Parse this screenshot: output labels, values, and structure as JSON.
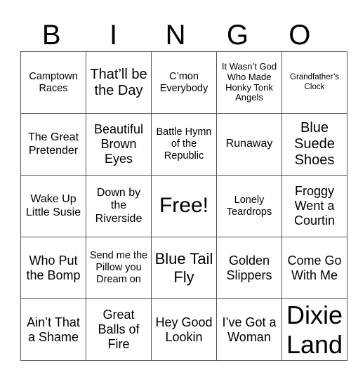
{
  "header": [
    "B",
    "I",
    "N",
    "G",
    "O"
  ],
  "rows": [
    [
      "Camptown Races",
      "That’ll be the Day",
      "C’mon Everybody",
      "It Wasn’t God Who Made Honky Tonk Angels",
      "Grandfather’s Clock"
    ],
    [
      "The Great Pretender",
      "Beautiful Brown Eyes",
      "Battle Hymn of the Republic",
      "Runaway",
      "Blue Suede Shoes"
    ],
    [
      "Wake Up Little Susie",
      "Down by the Riverside",
      "Free!",
      "Lonely Teardrops",
      "Froggy Went a Courtin"
    ],
    [
      "Who Put the Bomp",
      "Send me the Pillow you Dream on",
      "Blue Tail Fly",
      "Golden Slippers",
      "Come Go With Me"
    ],
    [
      "Ain’t That a Shame",
      "Great Balls of Fire",
      "Hey Good Lookin",
      "I’ve Got a Woman",
      "Dixie Land"
    ]
  ]
}
